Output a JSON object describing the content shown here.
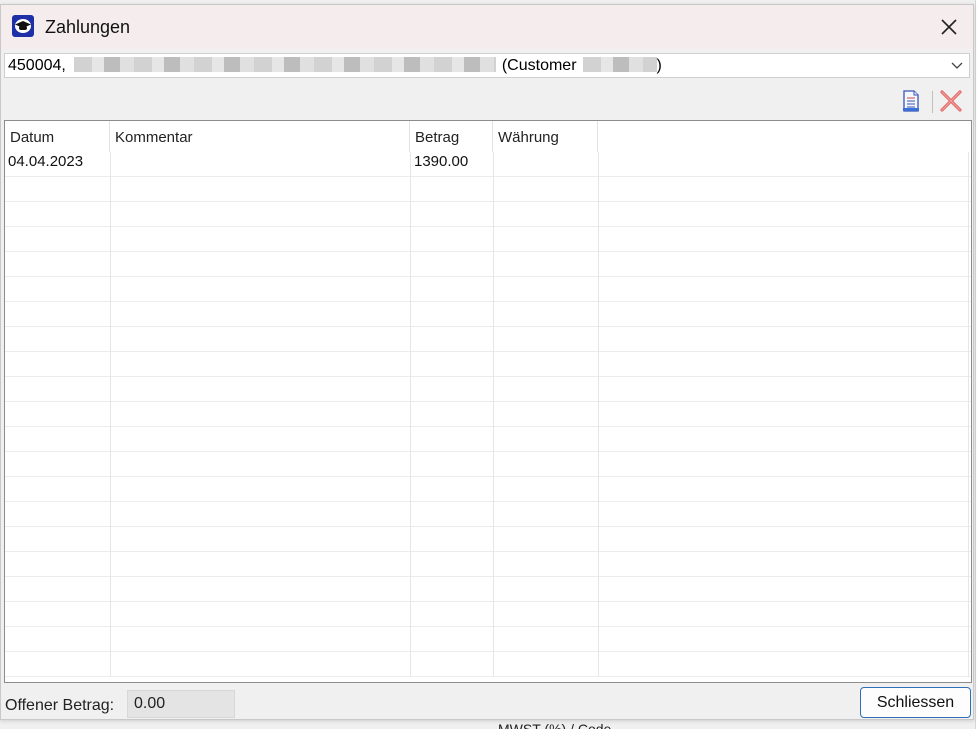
{
  "window": {
    "title": "Zahlungen"
  },
  "customer_select": {
    "value_prefix": "450004,",
    "value_suffix_open": "(Customer",
    "value_suffix_close": ")"
  },
  "toolbar": {
    "icons": [
      "new-document-icon",
      "delete-icon"
    ]
  },
  "table": {
    "columns": [
      "Datum",
      "Kommentar",
      "Betrag",
      "Währung"
    ],
    "rows": [
      [
        "04.04.2023",
        "",
        "1390.00",
        ""
      ]
    ]
  },
  "footer": {
    "open_amount_label": "Offener Betrag:",
    "open_amount_value": "0.00",
    "close_label": "Schliessen"
  },
  "background": {
    "partial_text": "MWST (%) / Code"
  },
  "colors": {
    "titlebar": "#f5eded",
    "accent_border": "#2f6fb5",
    "delete_red": "#e03a3a"
  }
}
